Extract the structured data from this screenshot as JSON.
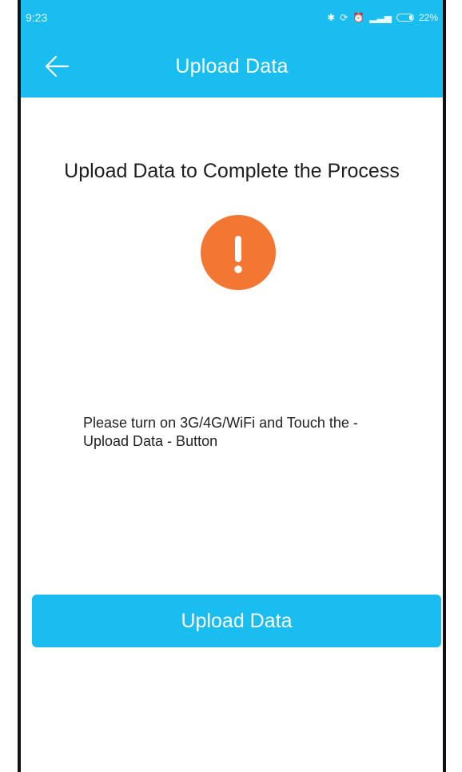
{
  "status_bar": {
    "time": "9:23",
    "battery": "22%",
    "battery_level": 0.22,
    "icons": [
      "bluetooth-icon",
      "sync-icon",
      "alarm-icon",
      "signal-icon",
      "battery-icon"
    ]
  },
  "app_bar": {
    "title": "Upload Data",
    "back_icon": "back-arrow-icon"
  },
  "content": {
    "headline": "Upload Data to Complete the Process",
    "warning_icon": "exclamation-icon",
    "instruction": "Please turn on 3G/4G/WiFi and Touch the - Upload Data - Button"
  },
  "actions": {
    "upload_label": "Upload Data"
  },
  "colors": {
    "primary": "#19bdf0",
    "warning": "#f37633",
    "text": "#1f1f1f"
  }
}
